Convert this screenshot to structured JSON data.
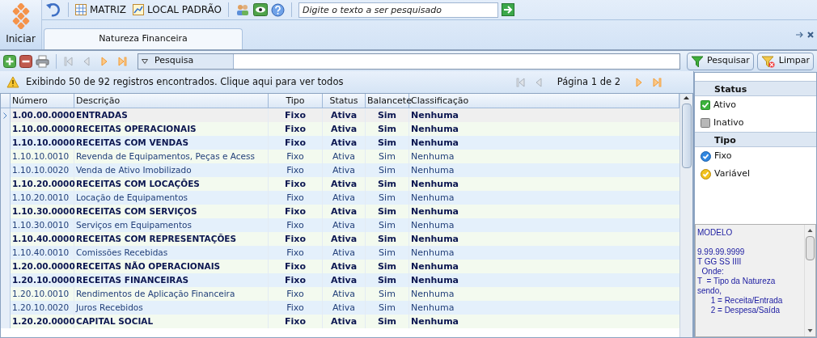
{
  "start_button": {
    "label": "Iniciar"
  },
  "toolbar": {
    "company": "MATRIZ",
    "location": "LOCAL PADRÃO",
    "search": {
      "placeholder": "Digite o texto a ser pesquisado"
    }
  },
  "tabs": [
    {
      "label": "Natureza Financeira",
      "selected": true
    }
  ],
  "record_toolbar": {
    "nav_buttons": [
      {
        "kind": "first",
        "disabled": true
      },
      {
        "kind": "prev",
        "disabled": true
      },
      {
        "kind": "next",
        "disabled": false
      },
      {
        "kind": "last",
        "disabled": false
      }
    ],
    "filter_label": "Pesquisa",
    "search_button": "Pesquisar",
    "clear_button": "Limpar"
  },
  "info_bar": {
    "message": "Exibindo 50 de 92 registros encontrados. Clique aqui para ver todos",
    "page": "Página 1 de 2",
    "nav_buttons": [
      {
        "kind": "first",
        "disabled": true
      },
      {
        "kind": "prev",
        "disabled": true
      },
      {
        "kind": "next",
        "disabled": false
      },
      {
        "kind": "last",
        "disabled": false
      }
    ]
  },
  "table": {
    "columns": [
      "Número",
      "Descrição",
      "Tipo",
      "Status",
      "Balancete",
      "Classificação"
    ],
    "rows": [
      {
        "kind": "group",
        "selected": true,
        "cells": [
          "1.00.00.0000",
          "ENTRADAS",
          "Fixo",
          "Ativa",
          "Sim",
          "Nenhuma"
        ]
      },
      {
        "kind": "group",
        "selected": false,
        "cells": [
          "1.10.00.0000",
          "RECEITAS OPERACIONAIS",
          "Fixo",
          "Ativa",
          "Sim",
          "Nenhuma"
        ]
      },
      {
        "kind": "group",
        "selected": false,
        "cells": [
          "1.10.10.0000",
          "RECEITAS COM VENDAS",
          "Fixo",
          "Ativa",
          "Sim",
          "Nenhuma"
        ]
      },
      {
        "kind": "item",
        "selected": false,
        "cells": [
          "1.10.10.0010",
          "Revenda de Equipamentos, Peças e Acess",
          "Fixo",
          "Ativa",
          "Sim",
          "Nenhuma"
        ]
      },
      {
        "kind": "item",
        "selected": false,
        "cells": [
          "1.10.10.0020",
          "Venda de Ativo Imobilizado",
          "Fixo",
          "Ativa",
          "Sim",
          "Nenhuma"
        ]
      },
      {
        "kind": "group",
        "selected": false,
        "cells": [
          "1.10.20.0000",
          "RECEITAS COM LOCAÇÕES",
          "Fixo",
          "Ativa",
          "Sim",
          "Nenhuma"
        ]
      },
      {
        "kind": "item",
        "selected": false,
        "cells": [
          "1.10.20.0010",
          "Locação de Equipamentos",
          "Fixo",
          "Ativa",
          "Sim",
          "Nenhuma"
        ]
      },
      {
        "kind": "group",
        "selected": false,
        "cells": [
          "1.10.30.0000",
          "RECEITAS COM SERVIÇOS",
          "Fixo",
          "Ativa",
          "Sim",
          "Nenhuma"
        ]
      },
      {
        "kind": "item",
        "selected": false,
        "cells": [
          "1.10.30.0010",
          "Serviços em Equipamentos",
          "Fixo",
          "Ativa",
          "Sim",
          "Nenhuma"
        ]
      },
      {
        "kind": "group",
        "selected": false,
        "cells": [
          "1.10.40.0000",
          "RECEITAS COM REPRESENTAÇÕES",
          "Fixo",
          "Ativa",
          "Sim",
          "Nenhuma"
        ]
      },
      {
        "kind": "item",
        "selected": false,
        "cells": [
          "1.10.40.0010",
          "Comissões Recebidas",
          "Fixo",
          "Ativa",
          "Sim",
          "Nenhuma"
        ]
      },
      {
        "kind": "group",
        "selected": false,
        "cells": [
          "1.20.00.0000",
          "RECEITAS NÃO OPERACIONAIS",
          "Fixo",
          "Ativa",
          "Sim",
          "Nenhuma"
        ]
      },
      {
        "kind": "group",
        "selected": false,
        "cells": [
          "1.20.10.0000",
          "RECEITAS FINANCEIRAS",
          "Fixo",
          "Ativa",
          "Sim",
          "Nenhuma"
        ]
      },
      {
        "kind": "item",
        "selected": false,
        "cells": [
          "1.20.10.0010",
          "Rendimentos de Aplicação Financeira",
          "Fixo",
          "Ativa",
          "Sim",
          "Nenhuma"
        ]
      },
      {
        "kind": "item",
        "selected": false,
        "cells": [
          "1.20.10.0020",
          "Juros Recebidos",
          "Fixo",
          "Ativa",
          "Sim",
          "Nenhuma"
        ]
      },
      {
        "kind": "group",
        "selected": false,
        "cells": [
          "1.20.20.0000",
          "CAPITAL SOCIAL",
          "Fixo",
          "Ativa",
          "Sim",
          "Nenhuma"
        ]
      }
    ]
  },
  "legend": [
    {
      "title": "Status",
      "items": [
        {
          "kind": "active",
          "label": "Ativo"
        },
        {
          "kind": "inactive",
          "label": "Inativo"
        }
      ]
    },
    {
      "title": "Tipo",
      "items": [
        {
          "kind": "fixed",
          "label": "Fixo"
        },
        {
          "kind": "variable",
          "label": "Variável"
        }
      ]
    }
  ],
  "model_note": [
    "MODELO",
    "9.99.99.9999",
    "T GG SS IIII",
    "  Onde:",
    "T  = Tipo da Natureza",
    "sendo,",
    "      1 = Receita/Entrada",
    "      2 = Despesa/Saída"
  ]
}
